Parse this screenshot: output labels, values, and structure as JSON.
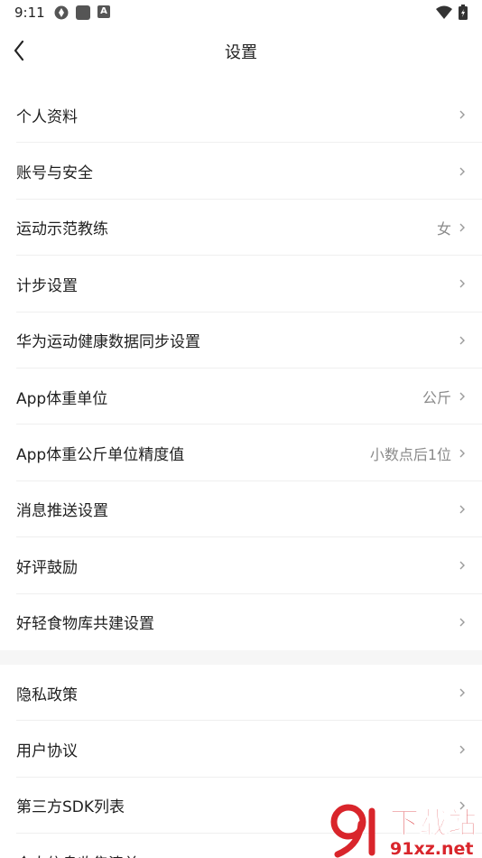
{
  "status_bar": {
    "time": "9:11",
    "a_badge": "A"
  },
  "header": {
    "title": "设置"
  },
  "settings_group_1": [
    {
      "label": "个人资料",
      "value": ""
    },
    {
      "label": "账号与安全",
      "value": ""
    },
    {
      "label": "运动示范教练",
      "value": "女"
    },
    {
      "label": "计步设置",
      "value": ""
    },
    {
      "label": "华为运动健康数据同步设置",
      "value": ""
    },
    {
      "label": "App体重单位",
      "value": "公斤"
    },
    {
      "label": "App体重公斤单位精度值",
      "value": "小数点后1位"
    },
    {
      "label": "消息推送设置",
      "value": ""
    },
    {
      "label": "好评鼓励",
      "value": ""
    },
    {
      "label": "好轻食物库共建设置",
      "value": ""
    }
  ],
  "settings_group_2": [
    {
      "label": "隐私政策",
      "value": ""
    },
    {
      "label": "用户协议",
      "value": ""
    },
    {
      "label": "第三方SDK列表",
      "value": ""
    },
    {
      "label": "个人信息收集清单",
      "value": ""
    }
  ],
  "watermark": {
    "brand": "下载站",
    "domain": "91xz.net"
  },
  "colors": {
    "text": "#1f1f1f",
    "secondary": "#8a8a8a",
    "divider": "#efefef",
    "watermark_red": "#d9252b"
  },
  "icons": {
    "back": "chevron-left-icon",
    "row_arrow": "chevron-right-icon"
  }
}
